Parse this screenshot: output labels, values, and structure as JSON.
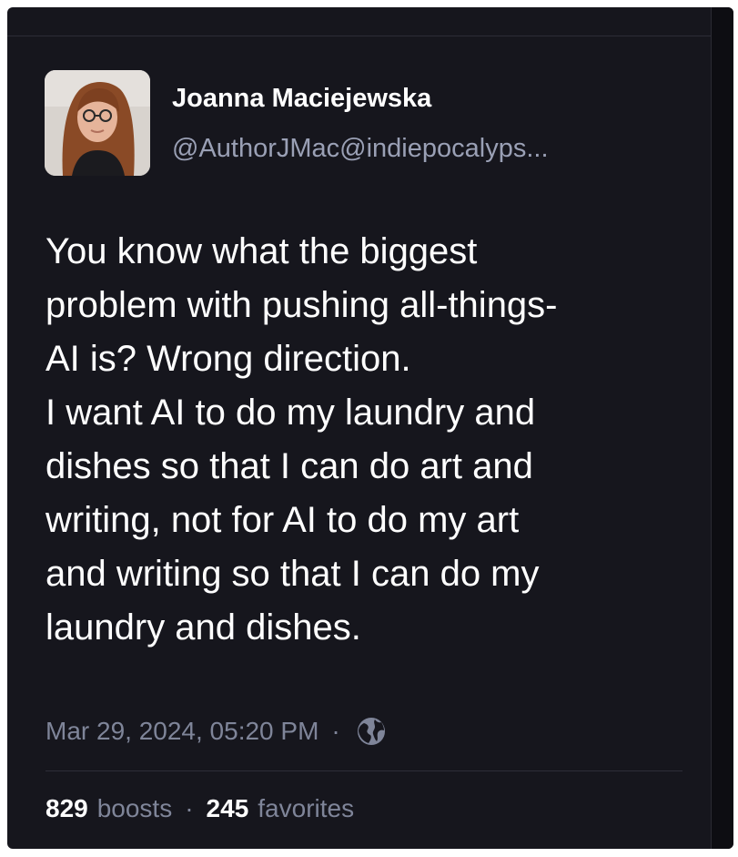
{
  "author": {
    "display_name": "Joanna Maciejewska",
    "handle": "@AuthorJMac@indiepocalyps..."
  },
  "post": {
    "lines": [
      "You know what the biggest",
      "problem with pushing all-things-",
      "AI is? Wrong direction.",
      "I want AI to do my laundry and",
      "dishes so that I can do art and",
      "writing, not for AI to do my art",
      "and writing so that I can do my",
      "laundry and dishes."
    ],
    "timestamp": "Mar 29, 2024, 05:20 PM",
    "separator": "·",
    "visibility_icon": "globe-icon"
  },
  "stats": {
    "boosts_count": "829",
    "boosts_label": "boosts",
    "favorites_count": "245",
    "favorites_label": "favorites",
    "separator": "·"
  },
  "colors": {
    "background": "#16161d",
    "text_primary": "#ffffff",
    "text_secondary": "#9aa0b5",
    "text_muted": "#7f8599"
  }
}
